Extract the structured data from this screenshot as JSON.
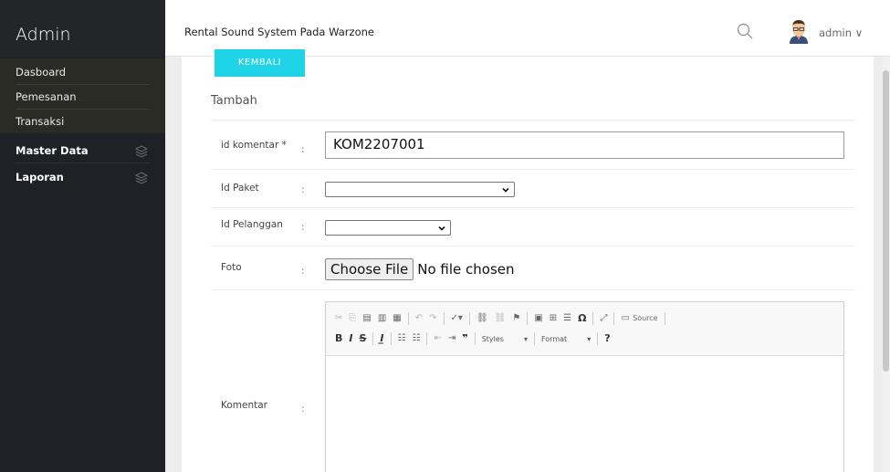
{
  "sidebar": {
    "brand": "Admin",
    "sub_items": [
      {
        "label": "Dasboard"
      },
      {
        "label": "Pemesanan"
      },
      {
        "label": "Transaksi"
      }
    ],
    "main_items": [
      {
        "label": "Master Data",
        "icon": "layers-icon"
      },
      {
        "label": "Laporan",
        "icon": "layers-icon"
      }
    ]
  },
  "header": {
    "title": "Rental Sound System Pada Warzone",
    "user": "admin ∨"
  },
  "form": {
    "back_button": "KEMBALI",
    "section_title": "Tambah",
    "fields": {
      "id_komentar": {
        "label": "id komentar *",
        "value": "KOM2207001"
      },
      "id_paket": {
        "label": "Id Paket",
        "value": ""
      },
      "id_pelanggan": {
        "label": "Id Pelanggan",
        "value": ""
      },
      "foto": {
        "label": "Foto",
        "button": "Choose File",
        "status": "No file chosen"
      },
      "komentar": {
        "label": "Komentar"
      }
    },
    "colon": ":"
  },
  "editor": {
    "toolbar_row2": {
      "styles": "Styles",
      "format": "Format",
      "help": "?"
    },
    "source": "Source"
  },
  "colors": {
    "sidebar_bg": "#1f2126",
    "accent": "#1ed3e6"
  }
}
